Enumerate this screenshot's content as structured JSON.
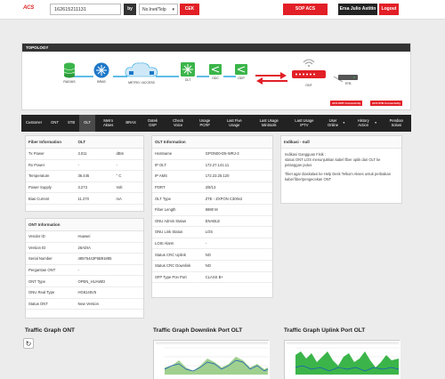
{
  "header": {
    "logo_main": "ACS",
    "logo_sub": "",
    "search_value": "162615211131",
    "by_label": "by",
    "search_type": "No.Inet/Telp",
    "check_label": "CEK",
    "sop_label": "SOP ACS",
    "user_name": "Ersa Julio Astitin",
    "logout_label": "Logout"
  },
  "topology": {
    "title": "TOPOLOGY",
    "nodes": [
      "RADIUS",
      "BRAS",
      "METRO / ACCESS",
      "OLT",
      "ODC",
      "ODP",
      "ONT",
      "STB"
    ],
    "badges": [
      "ACS ONT Connectivity",
      "ACS STB Connectivity"
    ]
  },
  "tabs": [
    {
      "label": "Customer"
    },
    {
      "label": "ONT"
    },
    {
      "label": "STB"
    },
    {
      "label": "OLT",
      "active": true
    },
    {
      "label": "Metro Akses"
    },
    {
      "label": "BRAS"
    },
    {
      "label": "Datek OSP"
    },
    {
      "label": "Check Voice"
    },
    {
      "label": "Usage PCRF"
    },
    {
      "label": "Last Five Usage"
    },
    {
      "label": "Last Usage Minitools"
    },
    {
      "label": "Last Usage IPTV"
    },
    {
      "label": "User Online",
      "dropdown": true
    },
    {
      "label": "History Action",
      "dropdown": true
    },
    {
      "label": "Pendian Solusi"
    }
  ],
  "fiber": {
    "headers": [
      "Fiber Information",
      "OLT"
    ],
    "rows": [
      {
        "k": "Tx Power",
        "v": "3.011",
        "u": "dBm"
      },
      {
        "k": "Rx Power",
        "v": "-",
        "u": "-"
      },
      {
        "k": "Temperature",
        "v": "36.445",
        "u": "° C"
      },
      {
        "k": "Power Supply",
        "v": "3.273",
        "u": "Volt"
      },
      {
        "k": "Bias Current",
        "v": "11.270",
        "u": "mA"
      }
    ]
  },
  "ont": {
    "title": "ONT Information",
    "rows": [
      {
        "k": "Vendor ID",
        "v": "Huawei"
      },
      {
        "k": "Version ID",
        "v": "26ADIA"
      },
      {
        "k": "Serial Number",
        "v": "48575443F6B91885"
      },
      {
        "k": "Pergantian ONT",
        "v": "-"
      },
      {
        "k": "ONT Type",
        "v": "OPEN_HUAWEI"
      },
      {
        "k": "ONU Real Type",
        "v": "HG8145V5"
      },
      {
        "k": "Status ONT",
        "v": "New Version"
      }
    ]
  },
  "olt": {
    "headers": [
      "OLT Information",
      ""
    ],
    "rows": [
      {
        "k": "Hostname",
        "v": "GPON00-D5-WRJ-3"
      },
      {
        "k": "IP OLT",
        "v": "172.27.141.11"
      },
      {
        "k": "IP AMS",
        "v": "172.23.25.120"
      },
      {
        "k": "PORT",
        "v": "2/8/13"
      },
      {
        "k": "OLT Type",
        "v": "ZTE - ZXPON C300v2"
      },
      {
        "k": "Fiber Length",
        "v": "6980 M"
      },
      {
        "k": "ONU Admin Status",
        "v": "ENABLE"
      },
      {
        "k": "ONU Link Status",
        "v": "LOS"
      },
      {
        "k": "LOSI Alarm",
        "v": "-"
      },
      {
        "k": "Status CRC Uplink",
        "v": "NO"
      },
      {
        "k": "Status CRC Downlink",
        "v": "NO"
      },
      {
        "k": "SFP Type Pon Port",
        "v": "CLASS B+"
      }
    ]
  },
  "indikasi": {
    "title": "Indikasi - null",
    "line1": "Indikasi Gangguan Fisik :",
    "line2": "status ONT LOS menunjukkan kabel fiber optik dari OLT ke pelanggan putus",
    "line3": "Tiket agar diaskalasi ke Help Desk Telkom Akses untuk perbaikan kabel fiber/pengecekan ONT"
  },
  "graphs": {
    "ont_title": "Traffic Graph ONT",
    "down_title": "Traffic Graph Downlink Port OLT",
    "up_title": "Traffic Graph Uplink Port OLT",
    "refresh_icon": "refresh-icon"
  }
}
